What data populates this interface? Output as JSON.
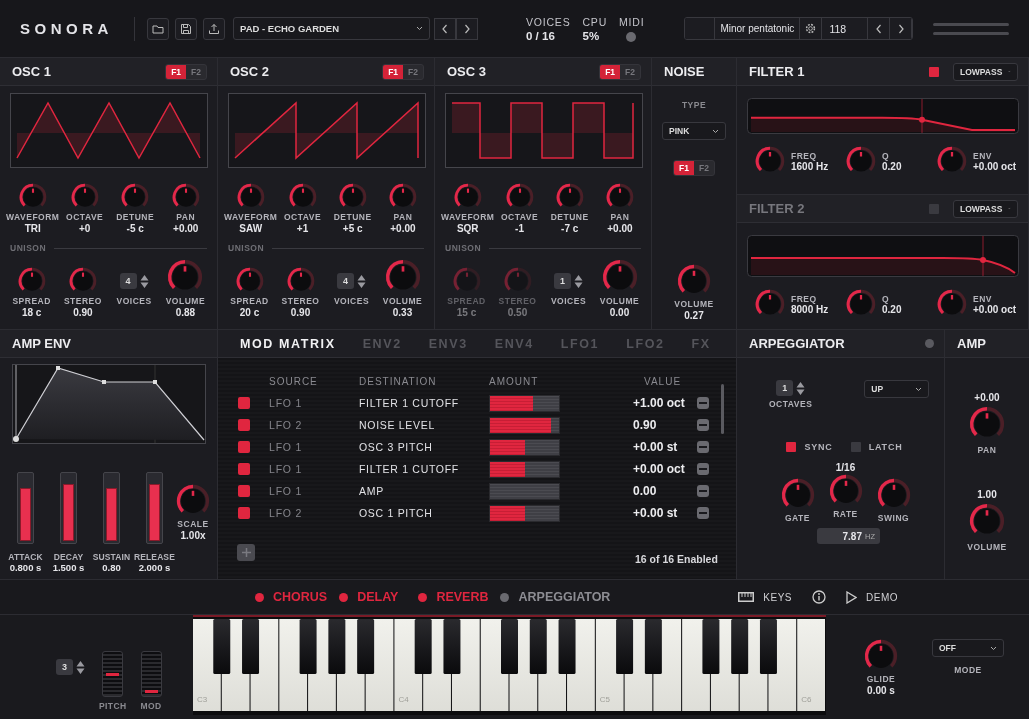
{
  "header": {
    "logo": "SONORA",
    "preset": "PAD - ECHO GARDEN",
    "stats": [
      {
        "label": "VOICES",
        "value": "0 / 16"
      },
      {
        "label": "CPU",
        "value": "5%"
      }
    ],
    "midi": {
      "label": "MIDI",
      "active": false
    },
    "scale": "Minor pentatonic",
    "tempo": "118"
  },
  "oscillators": [
    {
      "title": "OSC 1",
      "kind": "triangle",
      "routes": [
        {
          "label": "F1",
          "selected": true
        },
        {
          "label": "F2",
          "selected": false
        }
      ],
      "knobs": [
        {
          "label": "WAVEFORM",
          "value": "TRI"
        },
        {
          "label": "OCTAVE",
          "value": "+0"
        },
        {
          "label": "DETUNE",
          "value": "-5 c"
        },
        {
          "label": "PAN",
          "value": "+0.00"
        }
      ],
      "unison_label": "UNISON",
      "unison": [
        {
          "label": "SPREAD",
          "value": "18 c",
          "disabled": false
        },
        {
          "label": "STEREO",
          "value": "0.90",
          "disabled": false
        }
      ],
      "voices": {
        "label": "VOICES",
        "value": "4"
      },
      "volume": {
        "label": "VOLUME",
        "value": "0.88"
      }
    },
    {
      "title": "OSC 2",
      "kind": "saw",
      "routes": [
        {
          "label": "F1",
          "selected": true
        },
        {
          "label": "F2",
          "selected": false
        }
      ],
      "knobs": [
        {
          "label": "WAVEFORM",
          "value": "SAW"
        },
        {
          "label": "OCTAVE",
          "value": "+1"
        },
        {
          "label": "DETUNE",
          "value": "+5 c"
        },
        {
          "label": "PAN",
          "value": "+0.00"
        }
      ],
      "unison_label": "UNISON",
      "unison": [
        {
          "label": "SPREAD",
          "value": "20 c",
          "disabled": false
        },
        {
          "label": "STEREO",
          "value": "0.90",
          "disabled": false
        }
      ],
      "voices": {
        "label": "VOICES",
        "value": "4"
      },
      "volume": {
        "label": "VOLUME",
        "value": "0.33"
      }
    },
    {
      "title": "OSC 3",
      "kind": "square",
      "routes": [
        {
          "label": "F1",
          "selected": true
        },
        {
          "label": "F2",
          "selected": false
        }
      ],
      "knobs": [
        {
          "label": "WAVEFORM",
          "value": "SQR"
        },
        {
          "label": "OCTAVE",
          "value": "-1"
        },
        {
          "label": "DETUNE",
          "value": "-7 c"
        },
        {
          "label": "PAN",
          "value": "+0.00"
        }
      ],
      "unison_label": "UNISON",
      "unison": [
        {
          "label": "SPREAD",
          "value": "15 c",
          "disabled": true
        },
        {
          "label": "STEREO",
          "value": "0.50",
          "disabled": true
        }
      ],
      "voices": {
        "label": "VOICES",
        "value": "1"
      },
      "volume": {
        "label": "VOLUME",
        "value": "0.00"
      }
    }
  ],
  "noise": {
    "title": "NOISE",
    "type_label": "TYPE",
    "type": "PINK",
    "routes": [
      {
        "label": "F1",
        "selected": true
      },
      {
        "label": "F2",
        "selected": false
      }
    ],
    "volume": {
      "label": "VOLUME",
      "value": "0.27"
    }
  },
  "filters": [
    {
      "title": "FILTER 1",
      "enabled": true,
      "mode": "LOWPASS",
      "knobs": [
        {
          "label": "FREQ",
          "value": "1600 Hz"
        },
        {
          "label": "Q",
          "value": "0.20"
        },
        {
          "label": "ENV",
          "value": "+0.00 oct"
        }
      ]
    },
    {
      "title": "FILTER 2",
      "enabled": false,
      "mode": "LOWPASS",
      "knobs": [
        {
          "label": "FREQ",
          "value": "8000 Hz"
        },
        {
          "label": "Q",
          "value": "0.20"
        },
        {
          "label": "ENV",
          "value": "+0.00 oct"
        }
      ]
    }
  ],
  "amp_env": {
    "title": "AMP ENV",
    "sliders": [
      {
        "label": "ATTACK",
        "value": "0.800 s",
        "level": 0.8
      },
      {
        "label": "DECAY",
        "value": "1.500 s",
        "level": 0.87
      },
      {
        "label": "SUSTAIN",
        "value": "0.80",
        "level": 0.8
      },
      {
        "label": "RELEASE",
        "value": "2.000 s",
        "level": 0.87
      }
    ],
    "scale": {
      "label": "SCALE",
      "value": "1.00x"
    }
  },
  "mod_matrix": {
    "tabs": [
      {
        "label": "MOD MATRIX",
        "selected": true
      },
      {
        "label": "ENV2",
        "selected": false
      },
      {
        "label": "ENV3",
        "selected": false
      },
      {
        "label": "ENV4",
        "selected": false
      },
      {
        "label": "LFO1",
        "selected": false
      },
      {
        "label": "LFO2",
        "selected": false
      },
      {
        "label": "FX",
        "selected": false
      }
    ],
    "columns": [
      "SOURCE",
      "DESTINATION",
      "AMOUNT",
      "VALUE"
    ],
    "rows": [
      {
        "enabled": true,
        "source": "LFO 1",
        "destination": "FILTER 1 CUTOFF",
        "level": 0.63,
        "value": "+1.00 oct"
      },
      {
        "enabled": true,
        "source": "LFO 2",
        "destination": "NOISE LEVEL",
        "level": 0.89,
        "value": "0.90"
      },
      {
        "enabled": true,
        "source": "LFO 1",
        "destination": "OSC 3 PITCH",
        "level": 0.5,
        "value": "+0.00 st"
      },
      {
        "enabled": true,
        "source": "LFO 1",
        "destination": "FILTER 1 CUTOFF",
        "level": 0.5,
        "value": "+0.00 oct"
      },
      {
        "enabled": true,
        "source": "LFO 1",
        "destination": "AMP",
        "level": 0.0,
        "value": "0.00"
      },
      {
        "enabled": true,
        "source": "LFO 2",
        "destination": "OSC 1 PITCH",
        "level": 0.5,
        "value": "+0.00 st"
      }
    ],
    "footer": "16 of 16 Enabled"
  },
  "arpeggiator": {
    "title": "ARPEGGIATOR",
    "on": false,
    "octaves": {
      "label": "OCTAVES",
      "value": "1"
    },
    "direction": "UP",
    "toggles": [
      {
        "label": "SYNC",
        "checked": true
      },
      {
        "label": "LATCH",
        "checked": false
      }
    ],
    "gate": {
      "label": "GATE"
    },
    "rate": {
      "value": "1/16",
      "label": "RATE"
    },
    "swing": {
      "label": "SWING"
    },
    "readout": {
      "value": "7.87",
      "unit": "HZ"
    }
  },
  "amp": {
    "title": "AMP",
    "knobs": [
      {
        "value": "+0.00",
        "label": "PAN"
      },
      {
        "value": "1.00",
        "label": "VOLUME"
      }
    ]
  },
  "fx_bar": {
    "effects": [
      {
        "label": "CHORUS",
        "on": true
      },
      {
        "label": "DELAY",
        "on": true
      },
      {
        "label": "REVERB",
        "on": true
      },
      {
        "label": "ARPEGGIATOR",
        "on": false
      }
    ],
    "buttons": [
      {
        "kind": "keyboard",
        "label": "KEYS"
      },
      {
        "kind": "info"
      },
      {
        "kind": "play",
        "label": "DEMO"
      }
    ]
  },
  "performance": {
    "octave": "3",
    "wheels": [
      {
        "kind": "pitch",
        "label": "PITCH"
      },
      {
        "kind": "mod",
        "label": "MOD"
      }
    ],
    "keyboard": {
      "labels": [
        "C3",
        "C4",
        "C5",
        "C6"
      ]
    },
    "glide": {
      "label": "GLIDE",
      "value": "0.00 s"
    },
    "mode": {
      "value": "OFF",
      "label": "MODE"
    }
  }
}
